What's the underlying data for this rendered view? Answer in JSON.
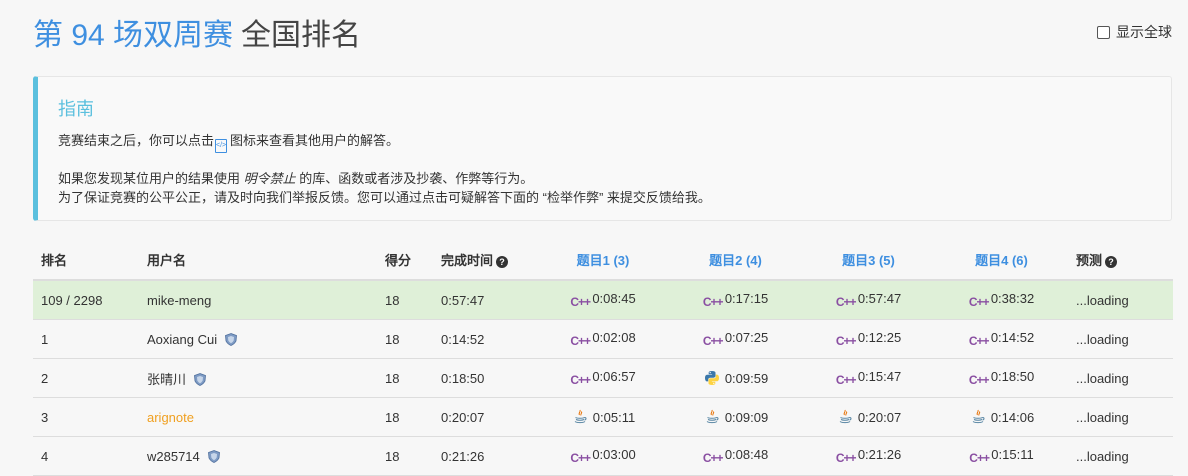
{
  "header": {
    "contest_name": "第 94 场双周赛",
    "title_suffix": "全国排名",
    "show_global_label": "显示全球"
  },
  "guide": {
    "title": "指南",
    "line1_before": "竞赛结束之后，你可以点击",
    "line1_icon": "code-icon",
    "line1_after": "图标来查看其他用户的解答。",
    "line2_before": "如果您发现某位用户的结果使用",
    "line2_emph": "明令禁止",
    "line2_after": "的库、函数或者涉及抄袭、作弊等行为。",
    "line3": "为了保证竞赛的公平公正，请及时向我们举报反馈。您可以通过点击可疑解答下面的 “检举作弊” 来提交反馈给我。"
  },
  "table": {
    "headers": {
      "rank": "排名",
      "user": "用户名",
      "score": "得分",
      "finish": "完成时间",
      "q1": "题目1 (3)",
      "q2": "题目2 (4)",
      "q3": "题目3 (5)",
      "q4": "题目4 (6)",
      "predict": "预测"
    },
    "rows": [
      {
        "rank": "109 / 2298",
        "user": "mike-meng",
        "badge": false,
        "score": "18",
        "finish": "0:57:47",
        "q": [
          {
            "lang": "cpp",
            "time": "0:08:45"
          },
          {
            "lang": "cpp",
            "time": "0:17:15"
          },
          {
            "lang": "cpp",
            "time": "0:57:47"
          },
          {
            "lang": "cpp",
            "time": "0:38:32"
          }
        ],
        "predict": "...loading"
      },
      {
        "rank": "1",
        "user": "Aoxiang Cui",
        "badge": true,
        "score": "18",
        "finish": "0:14:52",
        "q": [
          {
            "lang": "cpp",
            "time": "0:02:08"
          },
          {
            "lang": "cpp",
            "time": "0:07:25"
          },
          {
            "lang": "cpp",
            "time": "0:12:25"
          },
          {
            "lang": "cpp",
            "time": "0:14:52"
          }
        ],
        "predict": "...loading"
      },
      {
        "rank": "2",
        "user": "张晴川",
        "badge": true,
        "score": "18",
        "finish": "0:18:50",
        "q": [
          {
            "lang": "cpp",
            "time": "0:06:57"
          },
          {
            "lang": "python",
            "time": "0:09:59"
          },
          {
            "lang": "cpp",
            "time": "0:15:47"
          },
          {
            "lang": "cpp",
            "time": "0:18:50"
          }
        ],
        "predict": "...loading"
      },
      {
        "rank": "3",
        "user": "arignote",
        "badge": false,
        "score": "18",
        "finish": "0:20:07",
        "q": [
          {
            "lang": "java",
            "time": "0:05:11"
          },
          {
            "lang": "java",
            "time": "0:09:09"
          },
          {
            "lang": "java",
            "time": "0:20:07"
          },
          {
            "lang": "java",
            "time": "0:14:06"
          }
        ],
        "predict": "...loading"
      },
      {
        "rank": "4",
        "user": "w285714",
        "badge": true,
        "score": "18",
        "finish": "0:21:26",
        "q": [
          {
            "lang": "cpp",
            "time": "0:03:00"
          },
          {
            "lang": "cpp",
            "time": "0:08:48"
          },
          {
            "lang": "cpp",
            "time": "0:21:26"
          },
          {
            "lang": "cpp",
            "time": "0:15:11"
          }
        ],
        "predict": "...loading"
      }
    ]
  },
  "colors": {
    "accent": "#3e8fe0",
    "guide_border": "#5bc0de",
    "highlight_row": "#dff0d8",
    "orange_user": "#f0a020",
    "cpp_icon": "#8a4fa2"
  }
}
